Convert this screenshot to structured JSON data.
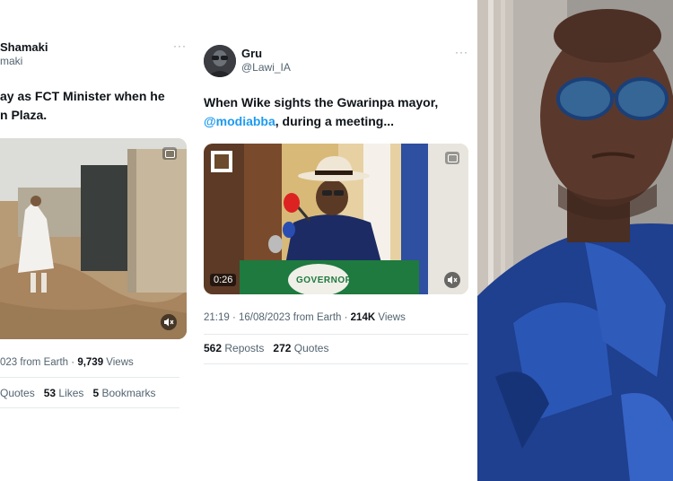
{
  "left_tweet": {
    "user_name": "Shamaki",
    "user_handle": "maki",
    "more": "···",
    "text_line1": "ay as FCT Minister when he",
    "text_line2": "n Plaza.",
    "meta_date": "023 from Earth",
    "meta_sep": " · ",
    "meta_views_count": "9,739",
    "meta_views_label": " Views",
    "quotes_label": "Quotes",
    "likes_count": "53",
    "likes_label": " Likes",
    "bookmarks_count": "5",
    "bookmarks_label": " Bookmarks",
    "media_icon": "gif-icon",
    "volume_icon": "volume-icon"
  },
  "mid_tweet": {
    "user_name": "Gru",
    "user_handle": "@Lawi_IA",
    "more": "···",
    "text_line1": "When Wike sights the Gwarinpa mayor,",
    "mention": "@modiabba",
    "text_line2_rest": ", during a meeting...",
    "duration": "0:26",
    "podium_text": "GOVERNOR",
    "meta_time": "21:19 · 16/08/2023 from Earth · ",
    "meta_views_count": "214K",
    "meta_views_label": " Views",
    "reposts_count": "562",
    "reposts_label": " Reposts",
    "quotes_count": "272",
    "quotes_label": " Quotes",
    "media_icon": "gif-icon",
    "volume_icon": "volume-icon"
  },
  "colors": {
    "text": "#0f1419",
    "secondary": "#536471",
    "link": "#1d9bf0",
    "divider": "#e6e9eb",
    "jacket_blue": "#1f3f8f"
  }
}
